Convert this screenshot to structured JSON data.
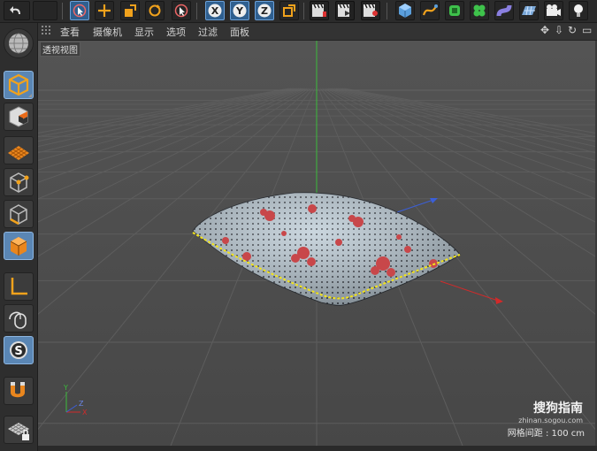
{
  "menu": {
    "view": "查看",
    "cameras": "摄像机",
    "display": "显示",
    "options": "选项",
    "filter": "过滤",
    "panel": "面板"
  },
  "viewport": {
    "label": "透视视图",
    "grid_spacing": "网格间距 : 100 cm"
  },
  "axis_labels": {
    "x": "X",
    "y": "Y",
    "z": "Z"
  },
  "toolbar": {
    "x_axis": "X",
    "y_axis": "Y",
    "z_axis": "Z"
  },
  "sidebar": {
    "snap_label": "S"
  },
  "watermark": {
    "logo": "搜狗指南",
    "url": "zhinan.sogou.com"
  },
  "colors": {
    "accent_blue": "#5a86b4",
    "viewport_bg": "#4d4d4d",
    "y_axis": "#3bbb3b",
    "x_axis": "#d22a2a",
    "z_axis": "#3b5fd8",
    "selection": "#f2e31b"
  }
}
